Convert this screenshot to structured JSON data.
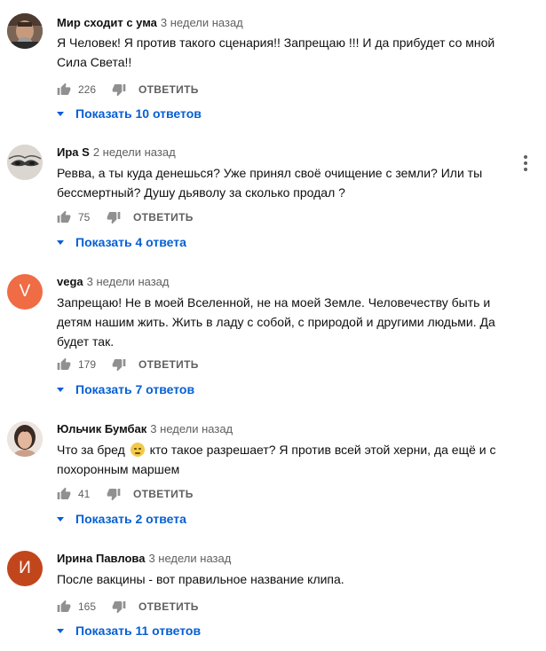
{
  "comments": [
    {
      "author": "Мир сходит с ума",
      "time": "3 недели назад",
      "text": "Я Человек! Я против такого сценария!! Запрещаю !!! И да прибудет со мной Сила Света!!",
      "likes": "226",
      "reply": "ОТВЕТИТЬ",
      "replies": "Показать 10 ответов",
      "avatar": {
        "type": "photo",
        "bg": "#6b4b3a"
      }
    },
    {
      "author": "Ира S",
      "time": "2 недели назад",
      "text": "Ревва, а ты куда денешься? Уже принял своё очищение с земли? Или ты бессмертный? Душу дьяволу за сколько продал ?",
      "likes": "75",
      "reply": "ОТВЕТИТЬ",
      "replies": "Показать 4 ответа",
      "avatar": {
        "type": "photo",
        "bg": "#d8d2cc"
      }
    },
    {
      "author": "vega",
      "time": "3 недели назад",
      "text": "Запрещаю! Не в моей Вселенной, не на моей Земле. Человечеству быть и детям нашим жить. Жить в ладу с собой, с природой и другими людьми. Да будет так.",
      "likes": "179",
      "reply": "ОТВЕТИТЬ",
      "replies": "Показать 7 ответов",
      "avatar": {
        "type": "letter",
        "letter": "V",
        "bg": "#ef6c45"
      }
    },
    {
      "author": "Юльчик Бумбак",
      "time": "3 недели назад",
      "text_before": "Что за бред",
      "text_after": "кто такое разрешает? Я против всей этой херни, да ещё и с похоронным маршем",
      "likes": "41",
      "reply": "ОТВЕТИТЬ",
      "replies": "Показать 2 ответа",
      "avatar": {
        "type": "photo",
        "bg": "#e9ddd5"
      }
    },
    {
      "author": "Ирина Павлова",
      "time": "3 недели назад",
      "text": "После вакцины - вот правильное название клипа.",
      "likes": "165",
      "reply": "ОТВЕТИТЬ",
      "replies": "Показать 11 ответов",
      "avatar": {
        "type": "letter",
        "letter": "И",
        "bg": "#c2461c"
      }
    }
  ],
  "icons": {
    "like": "thumbs-up-icon",
    "dislike": "thumbs-down-icon",
    "menu": "more-vert-icon",
    "expand": "caret-down-icon"
  },
  "colors": {
    "link": "#065fd4",
    "secondary_text": "#606060"
  }
}
